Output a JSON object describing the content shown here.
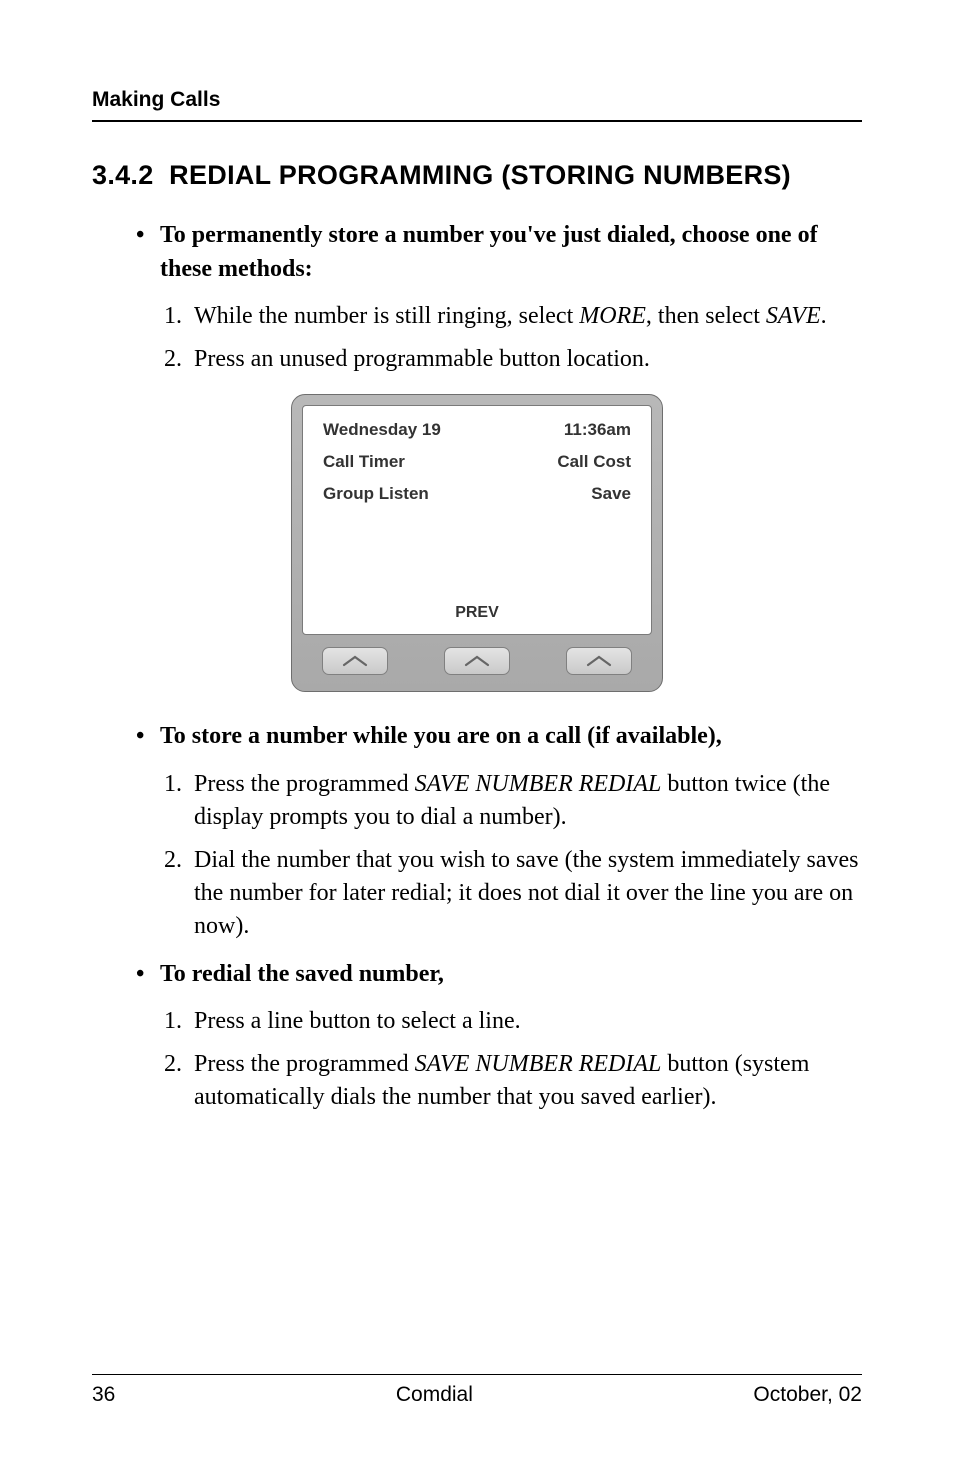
{
  "header": {
    "running": "Making Calls"
  },
  "section": {
    "number": "3.4.2",
    "title": "REDIAL PROGRAMMING (STORING NUMBERS)"
  },
  "blocks": [
    {
      "lead": "To permanently store a number you've just dialed, choose one of these methods:",
      "items": [
        {
          "num": "1.",
          "pre": "While the number is still ringing, select ",
          "em1": "MORE",
          "mid": ", then select ",
          "em2": "SAVE",
          "post": "."
        },
        {
          "num": "2.",
          "pre": "Press an unused programmable button location."
        }
      ]
    },
    {
      "lead": "To store a number while you are on a call (if available),",
      "items": [
        {
          "num": "1.",
          "pre": "Press the programmed ",
          "em1": "SAVE NUMBER REDIAL",
          "post": " button twice (the display prompts you to dial a number)."
        },
        {
          "num": "2.",
          "pre": "Dial the number that you wish to save (the system immediately saves the number for later redial; it does not dial it over the line you are on now)."
        }
      ]
    },
    {
      "lead": "To redial the saved number,",
      "items": [
        {
          "num": "1.",
          "pre": "Press a line button to select a line."
        },
        {
          "num": "2.",
          "pre": "Press the programmed ",
          "em1": "SAVE NUMBER REDIAL",
          "post": " button (system automatically dials the number that you saved earlier)."
        }
      ]
    }
  ],
  "phone": {
    "rows": [
      {
        "left": "Wednesday 19",
        "right": "11:36am"
      },
      {
        "left": "Call Timer",
        "right": "Call Cost"
      },
      {
        "left": "Group Listen",
        "right": "Save"
      }
    ],
    "bottom": "PREV"
  },
  "footer": {
    "page": "36",
    "center": "Comdial",
    "right": "October, 02"
  }
}
